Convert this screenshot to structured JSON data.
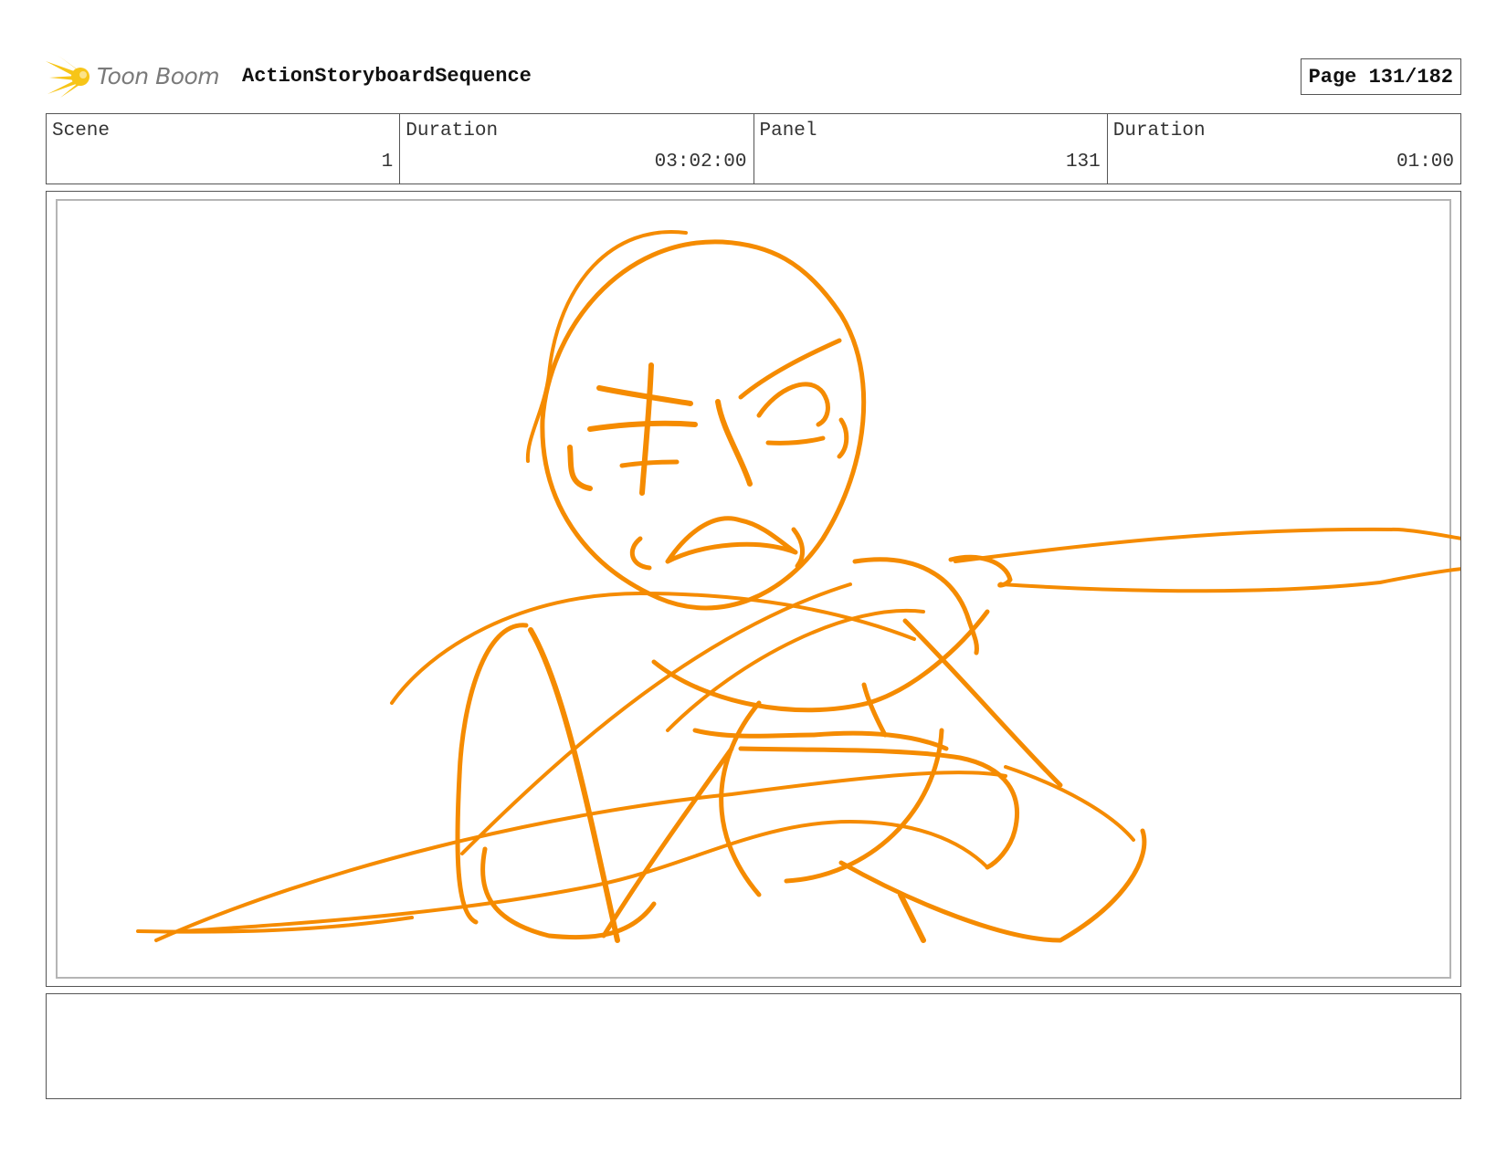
{
  "header": {
    "logo_text": "Toon Boom",
    "sequence_title": "ActionStoryboardSequence",
    "page_label": "Page 131/182"
  },
  "info": {
    "scene_label": "Scene",
    "scene_value": "1",
    "scene_duration_label": "Duration",
    "scene_duration_value": "03:02:00",
    "panel_label": "Panel",
    "panel_value": "131",
    "panel_duration_label": "Duration",
    "panel_duration_value": "01:00"
  },
  "colors": {
    "sketch_stroke": "#F58B00",
    "logo_yellow": "#F7C518",
    "frame_border": "#555555"
  },
  "icons": [
    "toon-boom-logo-icon"
  ]
}
